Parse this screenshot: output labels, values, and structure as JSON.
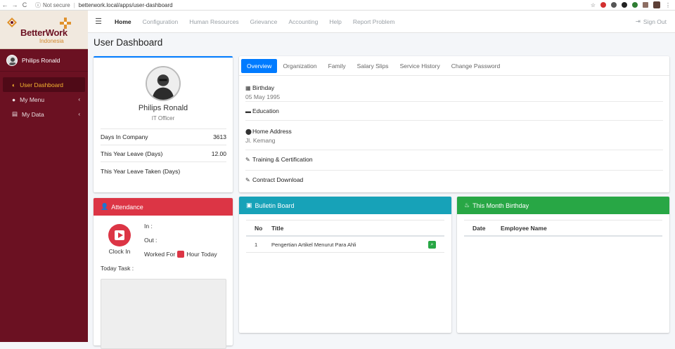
{
  "browser": {
    "back": "←",
    "forward": "→",
    "reload": "C",
    "secure_label": "Not secure",
    "url": "betterwork.local/apps/user-dashboard",
    "star": "☆"
  },
  "brand": {
    "name": "BetterWork",
    "sub": "Indonesia"
  },
  "user": {
    "name": "Philips Ronald"
  },
  "sidebar": {
    "items": [
      {
        "label": "User Dashboard",
        "icon": "dashboard-icon"
      },
      {
        "label": "My Menu",
        "icon": "user-icon",
        "chevron": "‹"
      },
      {
        "label": "My Data",
        "icon": "database-icon",
        "chevron": "‹"
      }
    ]
  },
  "topnav": {
    "menu_icon": "☰",
    "items": [
      "Home",
      "Configuration",
      "Human Resources",
      "Grievance",
      "Accounting",
      "Help",
      "Report Problem"
    ],
    "signout": "Sign Out"
  },
  "page_title": "User Dashboard",
  "profile": {
    "name": "Philips Ronald",
    "role": "IT Officer",
    "rows": [
      {
        "label": "Days In Company",
        "value": "3613"
      },
      {
        "label": "This Year Leave (Days)",
        "value": "12.00"
      },
      {
        "label": "This Year Leave Taken (Days)",
        "value": ""
      }
    ]
  },
  "details": {
    "tabs": [
      "Overview",
      "Organization",
      "Family",
      "Salary Slips",
      "Service History",
      "Change Password"
    ],
    "birthday_label": "Birthday",
    "birthday_value": "05 May 1995",
    "education_label": "Education",
    "address_label": "Home Address",
    "address_value": "Jl. Kemang",
    "training_label": "Training & Certification",
    "contract_label": "Contract Download"
  },
  "attendance": {
    "title": "Attendance",
    "clock_label": "Clock In",
    "in_label": "In :",
    "out_label": "Out :",
    "worked_prefix": "Worked For",
    "worked_suffix": "Hour Today",
    "task_label": "Today Task :"
  },
  "bulletin": {
    "title": "Bulletin Board",
    "col_no": "No",
    "col_title": "Title",
    "rows": [
      {
        "no": "1",
        "title": "Pengertian Artikel Menurut Para Ahli"
      }
    ]
  },
  "birthday": {
    "title": "This Month Birthday",
    "col_date": "Date",
    "col_name": "Employee Name"
  },
  "colors": {
    "sidebar": "#6b1122",
    "primary": "#007bff",
    "danger": "#dc3545",
    "info": "#17a2b8",
    "success": "#28a745",
    "accent": "#f7b531"
  }
}
